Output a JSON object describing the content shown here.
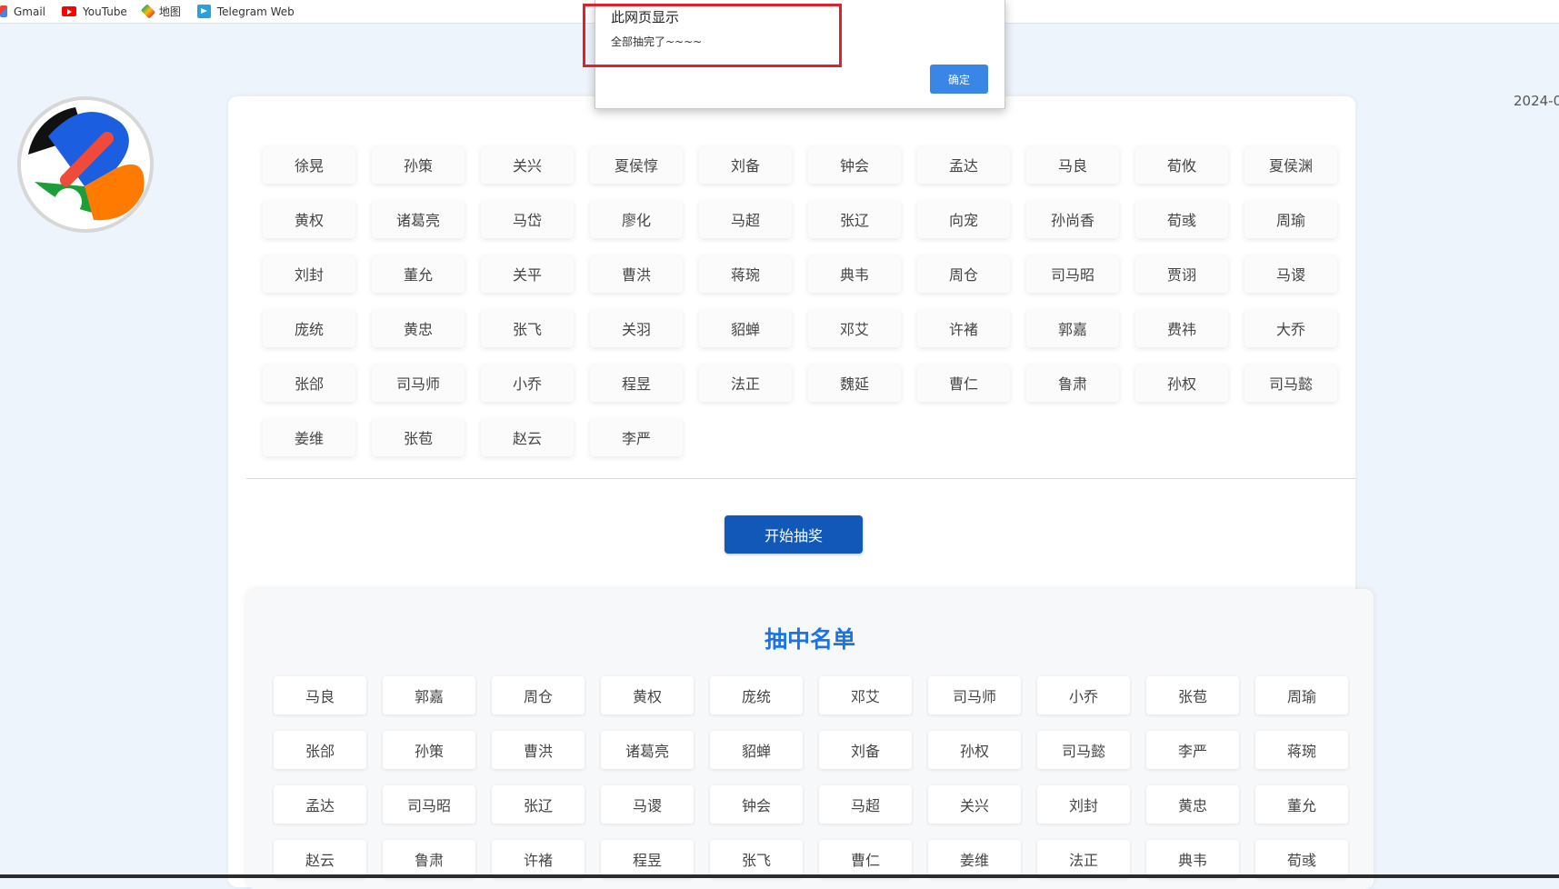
{
  "bookmarks": [
    {
      "label": "Gmail",
      "icon": "gmail-icon"
    },
    {
      "label": "YouTube",
      "icon": "youtube-icon"
    },
    {
      "label": "地图",
      "icon": "maps-icon"
    },
    {
      "label": "Telegram Web",
      "icon": "telegram-icon"
    }
  ],
  "date": "2024-0",
  "pool": {
    "names": [
      "徐晃",
      "孙策",
      "关兴",
      "夏侯惇",
      "刘备",
      "钟会",
      "孟达",
      "马良",
      "荀攸",
      "夏侯渊",
      "黄权",
      "诸葛亮",
      "马岱",
      "廖化",
      "马超",
      "张辽",
      "向宠",
      "孙尚香",
      "荀彧",
      "周瑜",
      "刘封",
      "董允",
      "关平",
      "曹洪",
      "蒋琬",
      "典韦",
      "周仓",
      "司马昭",
      "贾诩",
      "马谡",
      "庞统",
      "黄忠",
      "张飞",
      "关羽",
      "貂蝉",
      "邓艾",
      "许褚",
      "郭嘉",
      "费祎",
      "大乔",
      "张郃",
      "司马师",
      "小乔",
      "程昱",
      "法正",
      "魏延",
      "曹仁",
      "鲁肃",
      "孙权",
      "司马懿",
      "姜维",
      "张苞",
      "赵云",
      "李严"
    ]
  },
  "start_button": "开始抽奖",
  "winners": {
    "title": "抽中名单",
    "names": [
      "马良",
      "郭嘉",
      "周仓",
      "黄权",
      "庞统",
      "邓艾",
      "司马师",
      "小乔",
      "张苞",
      "周瑜",
      "张郃",
      "孙策",
      "曹洪",
      "诸葛亮",
      "貂蝉",
      "刘备",
      "孙权",
      "司马懿",
      "李严",
      "蒋琬",
      "孟达",
      "司马昭",
      "张辽",
      "马谡",
      "钟会",
      "马超",
      "关兴",
      "刘封",
      "黄忠",
      "董允",
      "赵云",
      "鲁肃",
      "许褚",
      "程昱",
      "张飞",
      "曹仁",
      "姜维",
      "法正",
      "典韦",
      "荀彧"
    ]
  },
  "dialog": {
    "title": "此网页显示",
    "message": "全部抽完了~~~~",
    "ok": "确定"
  },
  "colors": {
    "accent": "#1158b8",
    "winners_title": "#1a73e8",
    "highlight": "#e0202a",
    "dialog_ok": "#3a86e6"
  }
}
